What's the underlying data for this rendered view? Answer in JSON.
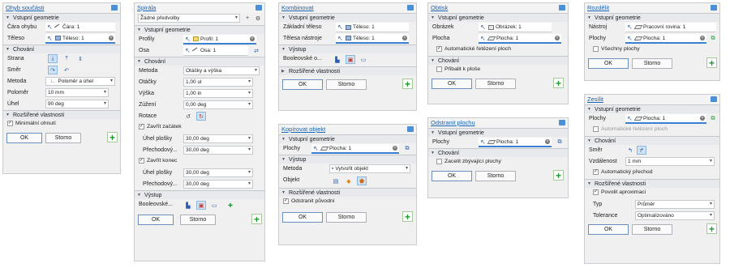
{
  "p1": {
    "title": "Ohyb součásti",
    "sec_input": "Vstupní geometrie",
    "bend_line_label": "Čára ohybu",
    "bend_line_value": "Čára: 1",
    "body_label": "Těleso",
    "body_value": "Těleso: 1",
    "sec_behavior": "Chování",
    "side_label": "Strana",
    "direction_label": "Směr",
    "method_label": "Metoda",
    "method_value": "Poloměr a úhel",
    "radius_label": "Poloměr",
    "radius_value": "10 mm",
    "angle_label": "Úhel",
    "angle_value": "90 deg",
    "sec_advanced": "Rozšířené vlastnosti",
    "min_bend_label": "Minimální ohnutí",
    "ok": "OK",
    "cancel": "Storno"
  },
  "p2": {
    "title": "Spirála",
    "preset_value": "Žádné předvolby",
    "sec_input": "Vstupní geometrie",
    "profiles_label": "Profily",
    "profiles_value": "Profil: 1",
    "axis_label": "Osa",
    "axis_value": "Osa: 1",
    "sec_behavior": "Chování",
    "method_label": "Metoda",
    "method_value": "Otáčky a výška",
    "turns_label": "Otáčky",
    "turns_value": "1,00 ul",
    "height_label": "Výška",
    "height_value": "1,00 in",
    "taper_label": "Zúžení",
    "taper_value": "0,00 deg",
    "rotation_label": "Rotace",
    "close_start_label": "Zavřít začátek",
    "flat_angle_label": "Úhel plošky",
    "flat_angle_value": "30,00 deg",
    "transition_label": "Přechodový...",
    "transition_value": "30,00 deg",
    "close_end_label": "Zavřít konec",
    "flat_angle2_label": "Úhel plošky",
    "flat_angle2_value": "30,00 deg",
    "transition2_label": "Přechodový...",
    "transition2_value": "30,00 deg",
    "sec_output": "Výstup",
    "boolean_label": "Booleovské...",
    "ok": "OK",
    "cancel": "Storno"
  },
  "p3": {
    "title": "Kombinovat",
    "sec_input": "Vstupní geometrie",
    "base_label": "Základní těleso",
    "base_value": "Těleso: 1",
    "tool_label": "Tělesa nástroje",
    "tool_value": "Těleso: 1",
    "sec_output": "Výstup",
    "boolean_label": "Booleovské o...",
    "sec_advanced": "Rozšířené vlastnosti",
    "ok": "OK",
    "cancel": "Storno"
  },
  "p4": {
    "title": "Kopírovat objekt",
    "sec_input": "Vstupní geometrie",
    "faces_label": "Plochy",
    "faces_value": "Plocha: 1",
    "sec_output": "Výstup",
    "method_label": "Metoda",
    "method_value": "Vytvořit objekt",
    "object_label": "Objekt",
    "sec_advanced": "Rozšířené vlastnosti",
    "remove_orig_label": "Odstranit původní",
    "ok": "OK",
    "cancel": "Storno"
  },
  "p5": {
    "title": "Obtisk",
    "sec_input": "Vstupní geometrie",
    "image_label": "Obrázek",
    "image_value": "Obrázek: 1",
    "face_label": "Plocha",
    "face_value": "Plocha: 1",
    "auto_chain_label": "Automatické řetězení ploch",
    "sec_behavior": "Chování",
    "wrap_label": "Přibalit k ploše",
    "ok": "OK",
    "cancel": "Storno"
  },
  "p6": {
    "title": "Odstranit plochu",
    "sec_input": "Vstupní geometrie",
    "faces_label": "Plochy",
    "faces_value": "Plocha: 1",
    "sec_behavior": "Chování",
    "fill_label": "Zacelit zbývající plochy",
    "ok": "OK",
    "cancel": "Storno"
  },
  "p7": {
    "title": "Rozdělit",
    "sec_input": "Vstupní geometrie",
    "tool_label": "Nástroj",
    "tool_value": "Pracovní rovina: 1",
    "faces_label": "Plochy",
    "faces_value": "Plocha: 1",
    "all_faces_label": "Všechny plochy",
    "ok": "OK",
    "cancel": "Storno"
  },
  "p8": {
    "title": "Zesílit",
    "sec_input": "Vstupní geometrie",
    "faces_label": "Plochy",
    "faces_value": "Plocha: 1",
    "auto_chain_label": "Automatické řetězení ploch",
    "sec_behavior": "Chování",
    "direction_label": "Směr",
    "distance_label": "Vzdálenost",
    "distance_value": "1 mm",
    "auto_transition_label": "Automatický přechod",
    "sec_advanced": "Rozšířené vlastnosti",
    "approx_label": "Povolit aproximaci",
    "type_label": "Typ",
    "type_value": "Průměr",
    "tolerance_label": "Tolerance",
    "tolerance_value": "Optimalizováno",
    "ok": "OK",
    "cancel": "Storno"
  },
  "colors": {
    "accent": "#3b7fd0",
    "title_link": "#1a62b4",
    "add_green": "#1d9a2c",
    "panel_bg": "#f0f0f0",
    "section_bg": "#e7e9ec"
  }
}
